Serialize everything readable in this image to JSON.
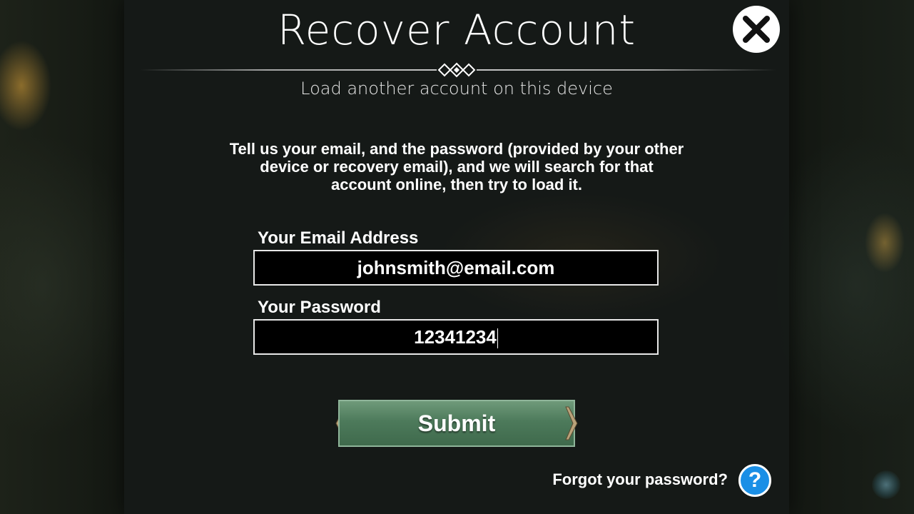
{
  "dialog": {
    "title": "Recover Account",
    "subtitle": "Load another account on this device",
    "instructions": "Tell us your email, and the password (provided by your other device or recovery email), and we will search for that account online, then try to load it."
  },
  "form": {
    "email_label": "Your Email Address",
    "email_value": "johnsmith@email.com",
    "password_label": "Your Password",
    "password_value": "12341234",
    "submit_label": "Submit",
    "forgot_label": "Forgot your password?",
    "help_symbol": "?"
  },
  "icons": {
    "close": "close-icon",
    "help": "help-icon",
    "ornament": "diamond-ornament-icon"
  },
  "colors": {
    "submit_green": "#4d7a5b",
    "help_blue": "#1a8fe6",
    "panel": "#161a18"
  }
}
